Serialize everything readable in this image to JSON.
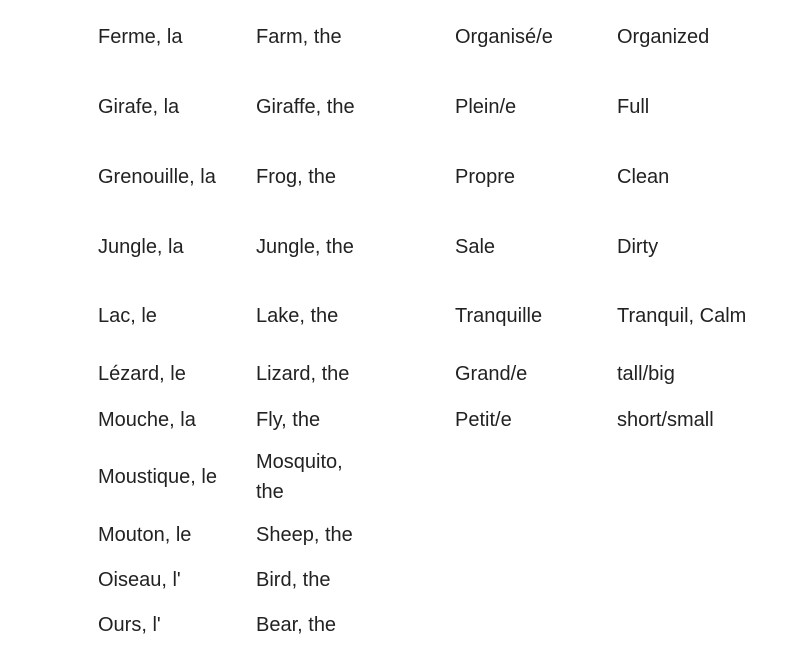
{
  "rows": [
    [
      "Ferme, la",
      "Farm, the",
      "Organisé/e",
      "Organized"
    ],
    [
      "Girafe, la",
      "Giraffe, the",
      "Plein/e",
      "Full"
    ],
    [
      "Grenouille, la",
      "Frog, the",
      "Propre",
      "Clean"
    ],
    [
      "Jungle, la",
      "Jungle, the",
      "Sale",
      "Dirty"
    ],
    [
      "Lac, le",
      "Lake, the",
      "Tranquille",
      "Tranquil, Calm"
    ],
    [
      "Lézard, le",
      "Lizard, the",
      "Grand/e",
      "tall/big"
    ],
    [
      "Mouche, la",
      "Fly, the",
      "Petit/e",
      "short/small"
    ],
    [
      "Moustique, le",
      "Mosquito, the",
      "",
      ""
    ],
    [
      "Mouton, le",
      "Sheep, the",
      "",
      ""
    ],
    [
      "Oiseau, l'",
      "Bird, the",
      "",
      ""
    ],
    [
      "Ours, l'",
      "Bear, the",
      "",
      ""
    ]
  ]
}
